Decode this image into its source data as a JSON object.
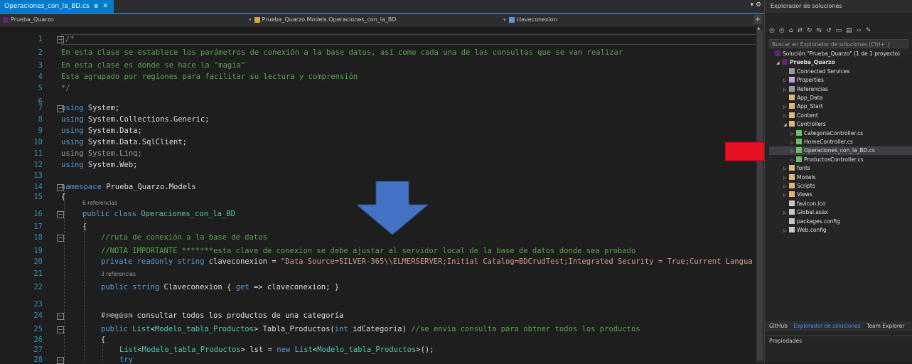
{
  "tab": {
    "label": "Operaciones_con_la_BD.cs",
    "pin": "⊕",
    "close": "✕"
  },
  "navbar": {
    "project": "Prueba_Quarzo",
    "class": "Prueba_Quarzo.Models.Operaciones_con_la_BD",
    "member": "claveconexion"
  },
  "code_lines": [
    {
      "n": "1",
      "parts": [
        {
          "t": "/*",
          "c": "c-comment"
        }
      ]
    },
    {
      "n": "2",
      "parts": [
        {
          "t": "En esta clase se establece los parámetros de conexión a la base datos, así como cada una de las consultas que se van realizar",
          "c": "c-comment"
        }
      ]
    },
    {
      "n": "3",
      "parts": [
        {
          "t": "En esta clase es donde se hace la \"magia\"",
          "c": "c-comment"
        }
      ]
    },
    {
      "n": "4",
      "parts": [
        {
          "t": "Esta agrupado por regiones para facilitar su lectura y comprensión",
          "c": "c-comment"
        }
      ]
    },
    {
      "n": "5",
      "parts": [
        {
          "t": "*/",
          "c": "c-comment"
        }
      ]
    },
    {
      "n": "6",
      "parts": []
    },
    {
      "n": "7",
      "parts": [
        {
          "t": "using",
          "c": "c-kw"
        },
        {
          "t": " System;",
          "c": ""
        }
      ]
    },
    {
      "n": "8",
      "parts": [
        {
          "t": "using",
          "c": "c-kw"
        },
        {
          "t": " System.Collections.Generic;",
          "c": ""
        }
      ]
    },
    {
      "n": "9",
      "parts": [
        {
          "t": "using",
          "c": "c-kw"
        },
        {
          "t": " System.Data;",
          "c": ""
        }
      ]
    },
    {
      "n": "10",
      "parts": [
        {
          "t": "using",
          "c": "c-kw"
        },
        {
          "t": " System.Data.SqlClient;",
          "c": ""
        }
      ]
    },
    {
      "n": "11",
      "parts": [
        {
          "t": "using System.Linq;",
          "c": "c-gray"
        }
      ]
    },
    {
      "n": "12",
      "parts": [
        {
          "t": "using",
          "c": "c-kw"
        },
        {
          "t": " System.Web;",
          "c": ""
        }
      ]
    },
    {
      "n": "13",
      "parts": []
    },
    {
      "n": "14",
      "parts": [
        {
          "t": "namespace",
          "c": "c-kw"
        },
        {
          "t": " Prueba_Quarzo.Models",
          "c": ""
        }
      ]
    },
    {
      "n": "15",
      "parts": [
        {
          "t": "{",
          "c": ""
        }
      ]
    },
    {
      "n": "16",
      "parts": [
        {
          "t": "public class ",
          "c": "c-kw"
        },
        {
          "t": "Operaciones_con_la_BD",
          "c": "c-type"
        }
      ]
    },
    {
      "n": "17",
      "parts": [
        {
          "t": "{",
          "c": ""
        }
      ]
    },
    {
      "n": "18",
      "parts": [
        {
          "t": "//ruta de conexión a la base de datos",
          "c": "c-comment"
        }
      ]
    },
    {
      "n": "19",
      "parts": [
        {
          "t": "//NOTA IMPORTANTE *******esta clave de conexion se debe ajustar al servidor local de la base de datos donde sea probado",
          "c": "c-comment"
        }
      ]
    },
    {
      "n": "20",
      "parts": [
        {
          "t": "private readonly string ",
          "c": "c-kw"
        },
        {
          "t": "claveconexion",
          "c": ""
        },
        {
          "t": " = ",
          "c": ""
        },
        {
          "t": "\"Data Source=SILVER-365\\\\ELMERSERVER;Initial Catalog=BDCrudTest;Integrated Security = True;Current Langua",
          "c": "c-str"
        }
      ]
    },
    {
      "n": "21",
      "parts": []
    },
    {
      "n": "22",
      "parts": [
        {
          "t": "public string ",
          "c": "c-kw"
        },
        {
          "t": "Claveconexion { ",
          "c": ""
        },
        {
          "t": "get",
          "c": "c-kw"
        },
        {
          "t": " => claveconexion; }",
          "c": ""
        }
      ]
    },
    {
      "n": "23",
      "parts": []
    },
    {
      "n": "24",
      "parts": [
        {
          "t": "#region ",
          "c": "c-region"
        },
        {
          "t": "consultar todos los productos de una categoría",
          "c": ""
        }
      ]
    },
    {
      "n": "25",
      "parts": [
        {
          "t": "public ",
          "c": "c-kw"
        },
        {
          "t": "List",
          "c": "c-type"
        },
        {
          "t": "<",
          "c": ""
        },
        {
          "t": "Modelo_tabla_Productos",
          "c": "c-type"
        },
        {
          "t": "> Tabla_Productos(",
          "c": ""
        },
        {
          "t": "int ",
          "c": "c-kw"
        },
        {
          "t": "idCategoria) ",
          "c": ""
        },
        {
          "t": "//se envia consulta para obtner todos los productos",
          "c": "c-comment"
        }
      ]
    },
    {
      "n": "26",
      "parts": [
        {
          "t": "{",
          "c": ""
        }
      ]
    },
    {
      "n": "27",
      "parts": [
        {
          "t": "List",
          "c": "c-type"
        },
        {
          "t": "<",
          "c": ""
        },
        {
          "t": "Modelo_tabla_Productos",
          "c": "c-type"
        },
        {
          "t": "> lst = ",
          "c": ""
        },
        {
          "t": "new ",
          "c": "c-kw"
        },
        {
          "t": "List",
          "c": "c-type"
        },
        {
          "t": "<",
          "c": ""
        },
        {
          "t": "Modelo_tabla_Productos",
          "c": "c-type"
        },
        {
          "t": ">();",
          "c": ""
        }
      ]
    },
    {
      "n": "28",
      "parts": [
        {
          "t": "try",
          "c": "c-kw"
        }
      ]
    }
  ],
  "lens": {
    "refs_class": "6 referencias",
    "refs_prop": "3 referencias",
    "refs_method": "1 referencia"
  },
  "solution_explorer": {
    "title": "Explorador de soluciones",
    "search_placeholder": "Buscar en Explorador de soluciones (Ctrl+`)",
    "items": [
      "Solución \"Prueba_Quarzo\" (1 de 1 proyecto)",
      "Prueba_Quarzo",
      "Connected Services",
      "Properties",
      "Referencias",
      "App_Data",
      "App_Start",
      "Content",
      "Controllers",
      "CategoriaController.cs",
      "HomeController.cs",
      "Operaciones_con_la_BD.cs",
      "ProductosController.cs",
      "fonts",
      "Models",
      "Scripts",
      "Views",
      "favicon.ico",
      "Global.asax",
      "packages.config",
      "Web.config"
    ],
    "bottom_tabs": [
      "GitHub",
      "Explorador de soluciones",
      "Team Explorer"
    ],
    "properties_title": "Propiedades"
  },
  "colors": {
    "accent": "#007acc",
    "red_arrow": "#e81123",
    "blue_arrow": "#4472c4"
  }
}
